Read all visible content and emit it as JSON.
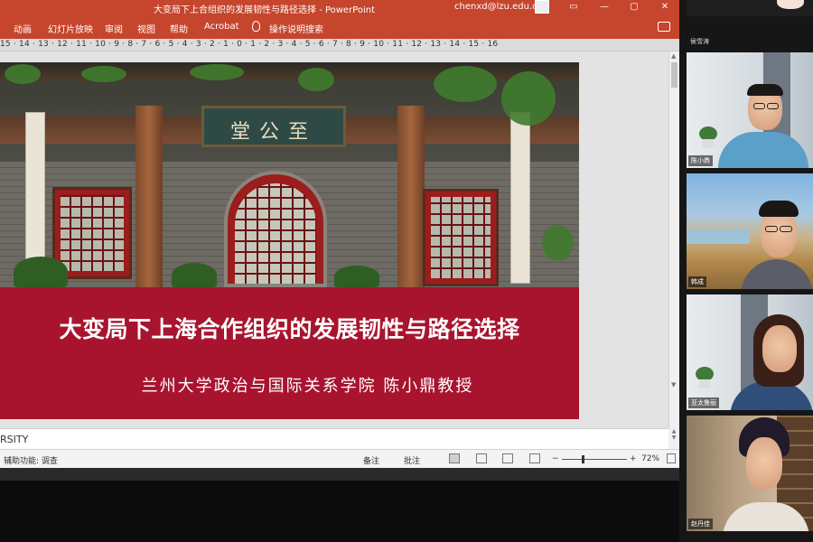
{
  "app": {
    "title": "大变局下上合组织的发展韧性与路径选择 - PowerPoint",
    "user": "chenxd@lzu.edu.cn",
    "window_controls": [
      "▭",
      "—",
      "▢",
      "✕"
    ]
  },
  "ribbon": {
    "tabs": [
      "动画",
      "幻灯片放映",
      "审阅",
      "视图",
      "帮助",
      "Acrobat"
    ],
    "search_label": "操作说明搜索"
  },
  "ruler": {
    "numbers": "15 · 14 · 13 · 12 · 11 · 10 · 9 · 8 · 7 · 6 · 5 · 4 · 3 · 2 · 1 · 0 · 1 · 2 · 3 · 4 · 5 · 6 · 7 · 8 · 9 · 10 · 11 · 12 · 13 · 14 · 15 · 16"
  },
  "slide": {
    "plaque": "堂公至",
    "title": "大变局下上海合作组织的发展韧性与路径选择",
    "author": "兰州大学政治与国际关系学院  陈小鼎教授"
  },
  "notes": {
    "text": "RSITY"
  },
  "statusbar": {
    "accessibility": "辅助功能: 调查",
    "notes_label": "备注",
    "comments_label": "批注",
    "zoom_minus": "−",
    "zoom_plus": "+",
    "zoom_level": "72%"
  },
  "participants": {
    "top_label": "侯雪涛",
    "tiles": [
      {
        "name": "陈小鼎"
      },
      {
        "name": "韩成"
      },
      {
        "name": "亚太鲁丽"
      },
      {
        "name": "赵丹佳"
      }
    ]
  },
  "colors": {
    "ppt_accent": "#c5452d",
    "banner": "#a8142e"
  }
}
